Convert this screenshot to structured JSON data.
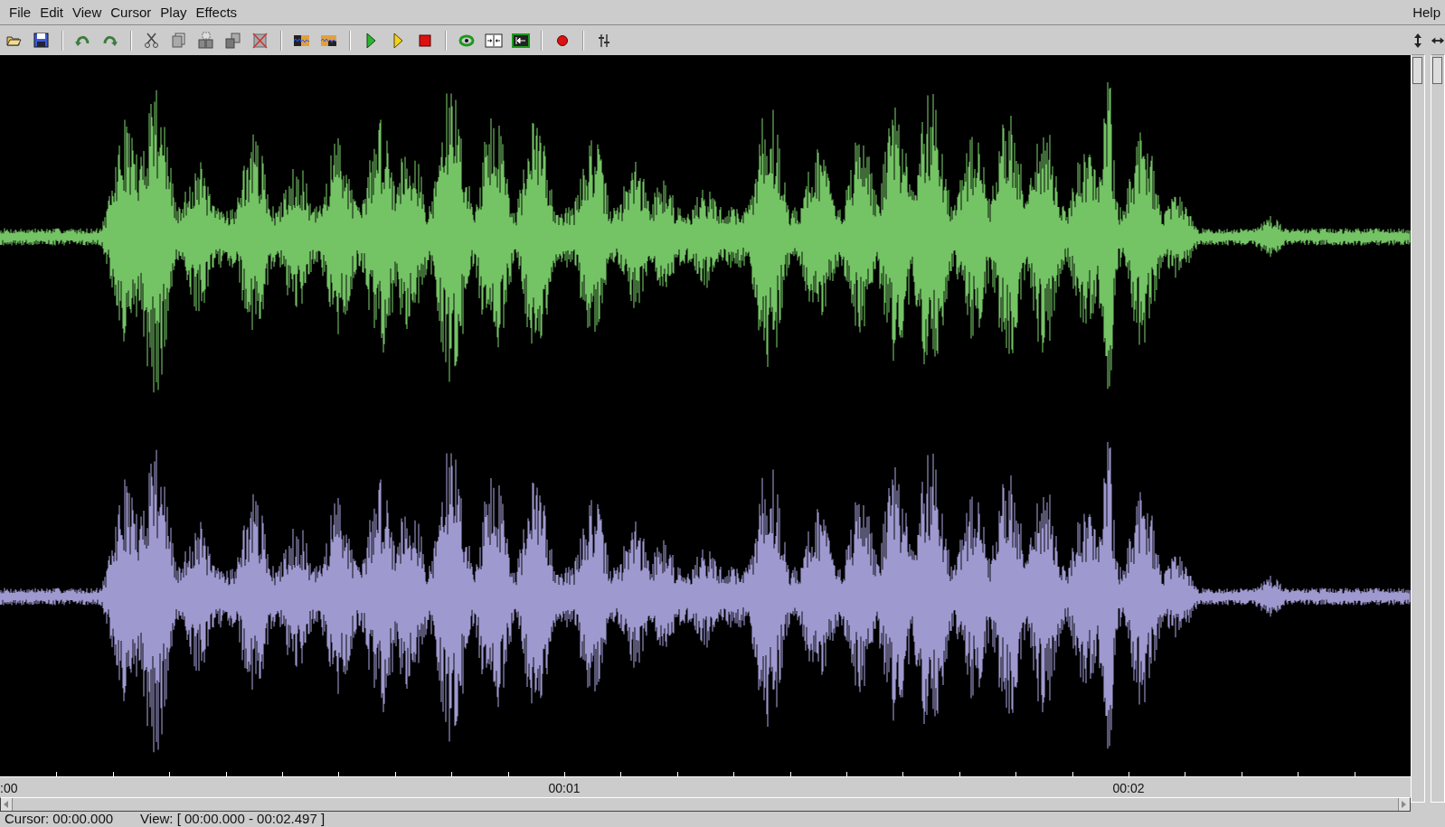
{
  "menu": [
    {
      "label": "File"
    },
    {
      "label": "Edit"
    },
    {
      "label": "View"
    },
    {
      "label": "Cursor"
    },
    {
      "label": "Play"
    },
    {
      "label": "Effects"
    }
  ],
  "help_menu": {
    "label": "Help"
  },
  "zoom_sliders": [
    {
      "level": 0
    },
    {
      "level": 0
    }
  ],
  "toolbar": [
    {
      "kind": "open"
    },
    {
      "kind": "save"
    },
    {
      "kind": "sep"
    },
    {
      "kind": "undo"
    },
    {
      "kind": "redo"
    },
    {
      "kind": "sep"
    },
    {
      "kind": "cut"
    },
    {
      "kind": "copy"
    },
    {
      "kind": "paste"
    },
    {
      "kind": "pastemix"
    },
    {
      "kind": "delete"
    },
    {
      "kind": "sep"
    },
    {
      "kind": "wave"
    },
    {
      "kind": "wave2"
    },
    {
      "kind": "sep"
    },
    {
      "kind": "play"
    },
    {
      "kind": "playsel"
    },
    {
      "kind": "stop"
    },
    {
      "kind": "sep"
    },
    {
      "kind": "loop"
    },
    {
      "kind": "fit"
    },
    {
      "kind": "home"
    },
    {
      "kind": "sep"
    },
    {
      "kind": "record"
    },
    {
      "kind": "sep"
    },
    {
      "kind": "mixer"
    }
  ],
  "channels": [
    {
      "color": "#74c365"
    },
    {
      "color": "#9e99cf"
    }
  ],
  "ruler": {
    "labels": [
      ":00",
      "00:01",
      "00:02"
    ]
  },
  "status_bar": {
    "cursor": "Cursor: 00:00.000",
    "view": "View: [ 00:00.000 - 00:02.497 ]"
  }
}
